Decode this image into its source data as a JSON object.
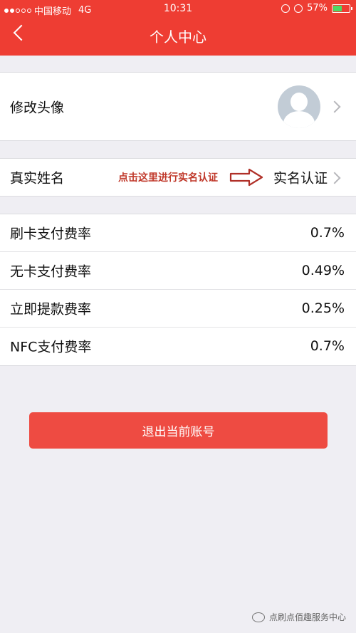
{
  "status_bar": {
    "carrier": "中国移动",
    "network": "4G",
    "time": "10:31",
    "battery": "57%"
  },
  "nav": {
    "title": "个人中心"
  },
  "profile": {
    "avatar_label": "修改头像",
    "name_label": "真实姓名",
    "annotation_text": "点击这里进行实名认证",
    "verify_label": "实名认证"
  },
  "rates": [
    {
      "label": "刷卡支付费率",
      "value": "0.7%"
    },
    {
      "label": "无卡支付费率",
      "value": "0.49%"
    },
    {
      "label": "立即提款费率",
      "value": "0.25%"
    },
    {
      "label": "NFC支付费率",
      "value": "0.7%"
    }
  ],
  "logout_label": "退出当前账号",
  "watermark": "点刷点佰趣服务中心",
  "colors": {
    "primary": "#ee3d33",
    "annotation": "#c0392b"
  }
}
